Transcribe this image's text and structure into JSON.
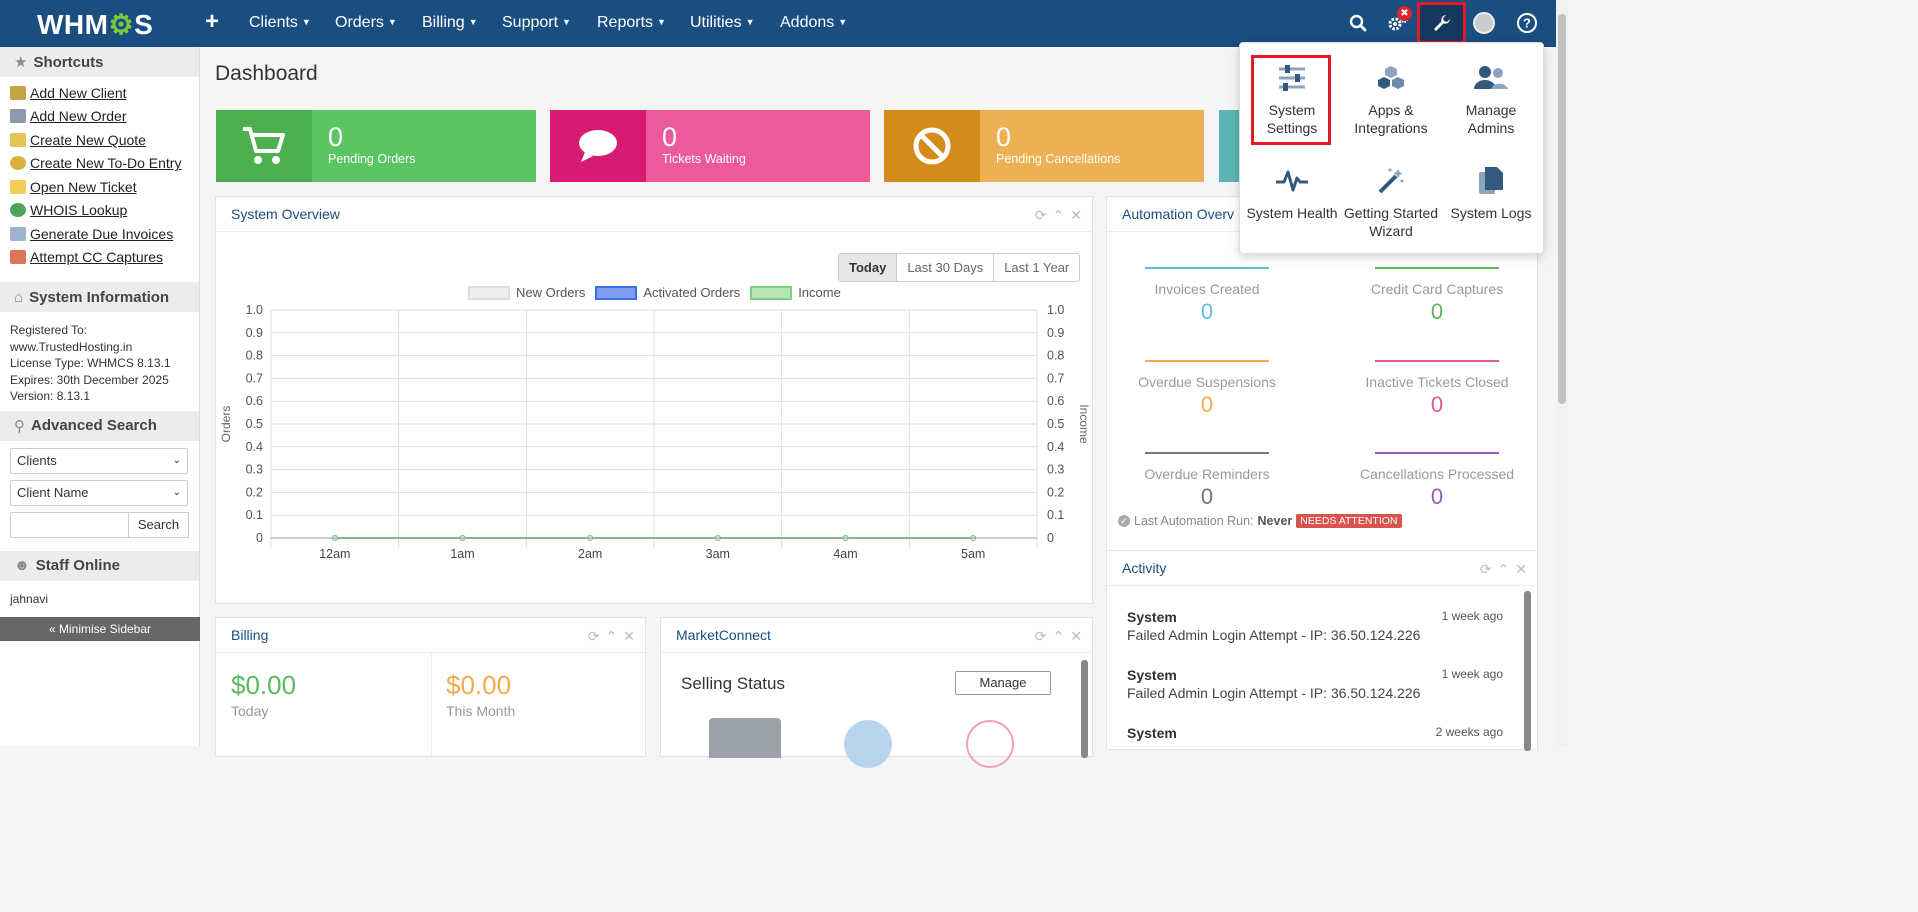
{
  "topbar": {
    "logo": "WHM",
    "logo_gear": "⚙",
    "logo_end": "S",
    "plus": "+",
    "menu": [
      "Clients",
      "Orders",
      "Billing",
      "Support",
      "Reports",
      "Utilities",
      "Addons"
    ],
    "notif_badge": "✖"
  },
  "sidebar": {
    "shortcuts_title": "Shortcuts",
    "shortcuts": [
      "Add New Client",
      "Add New Order",
      "Create New Quote",
      "Create New To-Do Entry",
      "Open New Ticket",
      "WHOIS Lookup",
      "Generate Due Invoices",
      "Attempt CC Captures"
    ],
    "sysinfo_title": "System Information",
    "sysinfo": [
      "Registered To:",
      "www.TrustedHosting.in",
      "License Type: WHMCS 8.13.1",
      "Expires: 30th December 2025",
      "Version: 8.13.1"
    ],
    "adv_title": "Advanced Search",
    "adv_select_1": "Clients",
    "adv_select_2": "Client Name",
    "search_value": "",
    "search_btn": "Search",
    "staff_title": "Staff Online",
    "staff": [
      "jahnavi"
    ],
    "minimise": "« Minimise Sidebar"
  },
  "main": {
    "title": "Dashboard",
    "stats": [
      {
        "num": "0",
        "label": "Pending Orders",
        "color": "#5cb85c",
        "dark": "#4cae4c"
      },
      {
        "num": "0",
        "label": "Tickets Waiting",
        "color": "#e8559a",
        "dark": "#d93d86"
      },
      {
        "num": "0",
        "label": "Pending Cancellations",
        "color": "#e9a84e",
        "dark": "#d48e22"
      }
    ],
    "overview": {
      "title": "System Overview",
      "tabs": [
        "Today",
        "Last 30 Days",
        "Last 1 Year"
      ],
      "legend": [
        "New Orders",
        "Activated Orders",
        "Income"
      ]
    },
    "automation": {
      "title": "Automation Overv",
      "cells": [
        {
          "label": "Invoices Created",
          "value": "0",
          "color": "#5bc0de"
        },
        {
          "label": "Credit Card Captures",
          "value": "0",
          "color": "#5cb85c"
        },
        {
          "label": "Overdue Suspensions",
          "value": "0",
          "color": "#f0ad4e"
        },
        {
          "label": "Inactive Tickets Closed",
          "value": "0",
          "color": "#e8559a"
        },
        {
          "label": "Overdue Reminders",
          "value": "0",
          "color": "#777777"
        },
        {
          "label": "Cancellations Processed",
          "value": "0",
          "color": "#9b59b6"
        }
      ],
      "last_run_label": "Last Automation Run:",
      "last_run_value": "Never",
      "badge": "NEEDS ATTENTION"
    },
    "activity": {
      "title": "Activity",
      "items": [
        {
          "who": "System",
          "when": "1 week ago",
          "desc": "Failed Admin Login Attempt - IP: 36.50.124.226"
        },
        {
          "who": "System",
          "when": "1 week ago",
          "desc": "Failed Admin Login Attempt - IP: 36.50.124.226"
        },
        {
          "who": "System",
          "when": "2 weeks ago",
          "desc": ""
        }
      ]
    },
    "billing": {
      "title": "Billing",
      "today_value": "$0.00",
      "today_label": "Today",
      "month_value": "$0.00",
      "month_label": "This Month"
    },
    "marketconnect": {
      "title": "MarketConnect",
      "selling_status": "Selling Status",
      "manage": "Manage"
    }
  },
  "dropdown": {
    "items": [
      "System Settings",
      "Apps & Integrations",
      "Manage Admins",
      "System Health",
      "Getting Started Wizard",
      "System Logs"
    ]
  },
  "chart_data": {
    "type": "line",
    "categories": [
      "12am",
      "1am",
      "2am",
      "3am",
      "4am",
      "5am"
    ],
    "series": [
      {
        "name": "New Orders",
        "values": [
          0,
          0,
          0,
          0,
          0,
          0
        ]
      },
      {
        "name": "Activated Orders",
        "values": [
          0,
          0,
          0,
          0,
          0,
          0
        ]
      },
      {
        "name": "Income",
        "values": [
          0,
          0,
          0,
          0,
          0,
          0
        ]
      }
    ],
    "ylabel": "Orders",
    "y2label": "Income",
    "ylim": [
      0,
      1
    ],
    "yticks": [
      "1.0",
      "0.9",
      "0.8",
      "0.7",
      "0.6",
      "0.5",
      "0.4",
      "0.3",
      "0.2",
      "0.1",
      "0"
    ],
    "grid": true,
    "legend": "top-center"
  }
}
